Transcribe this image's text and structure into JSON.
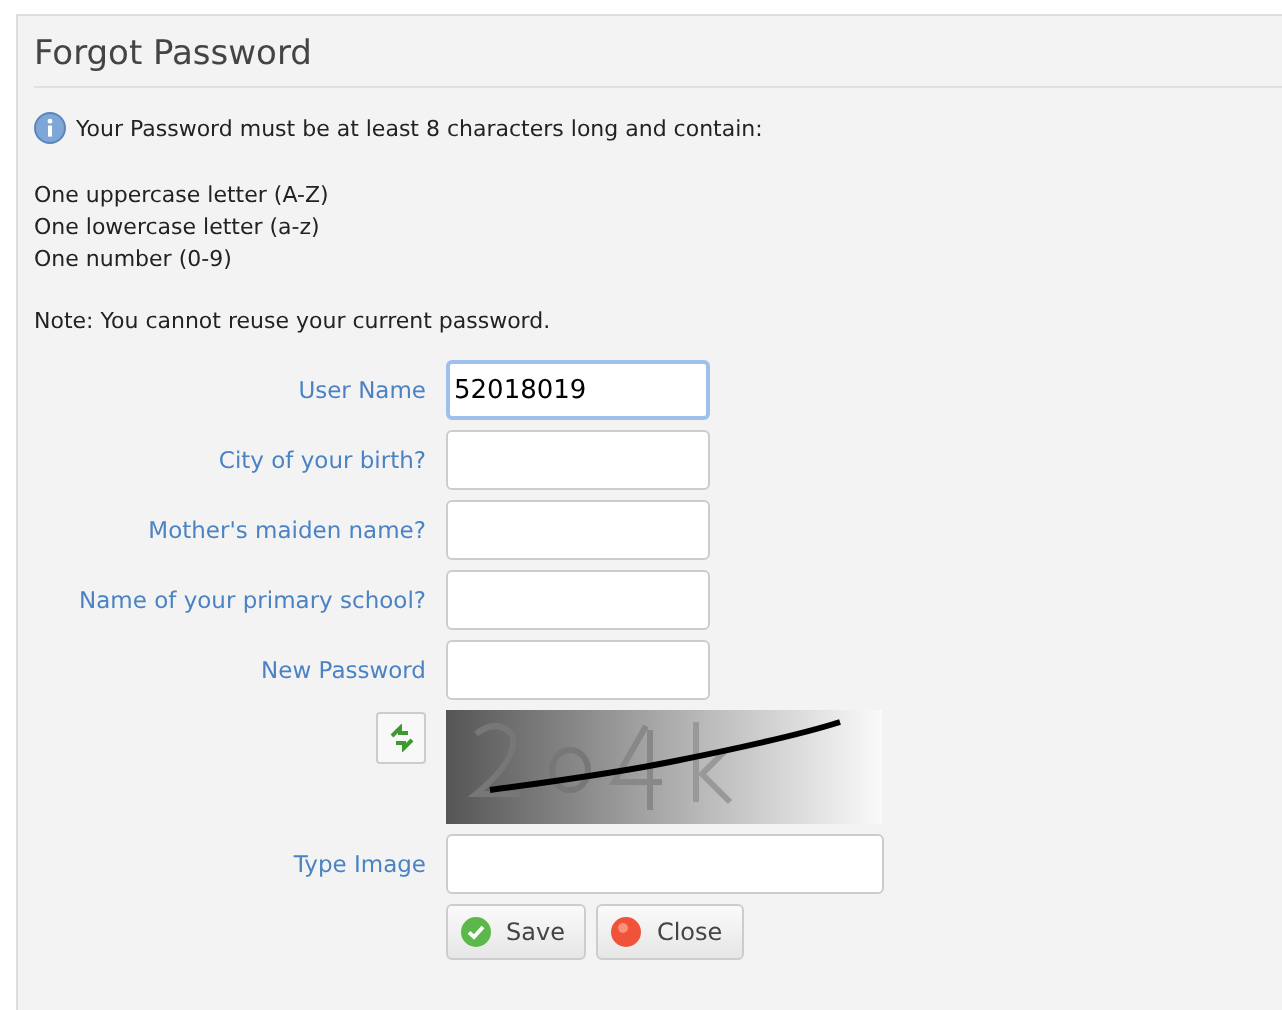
{
  "title": "Forgot Password",
  "info": "Your Password must be at least 8 characters long and contain:",
  "rules": [
    "One uppercase letter (A-Z)",
    "One lowercase letter (a-z)",
    "One number (0-9)"
  ],
  "note": "Note: You cannot reuse your current password.",
  "fields": [
    {
      "label": "User Name",
      "value": "52018019",
      "focused": true
    },
    {
      "label": "City of your birth?",
      "focused": false
    },
    {
      "label": "Mother's maiden name?",
      "focused": false
    },
    {
      "label": "Name of your primary school?",
      "focused": false
    },
    {
      "label": "New Password",
      "focused": false
    }
  ],
  "type_image": {
    "label": "Type Image"
  },
  "buttons": [
    {
      "label": "Save",
      "kind": "save"
    },
    {
      "label": "Close",
      "kind": "close"
    }
  ]
}
